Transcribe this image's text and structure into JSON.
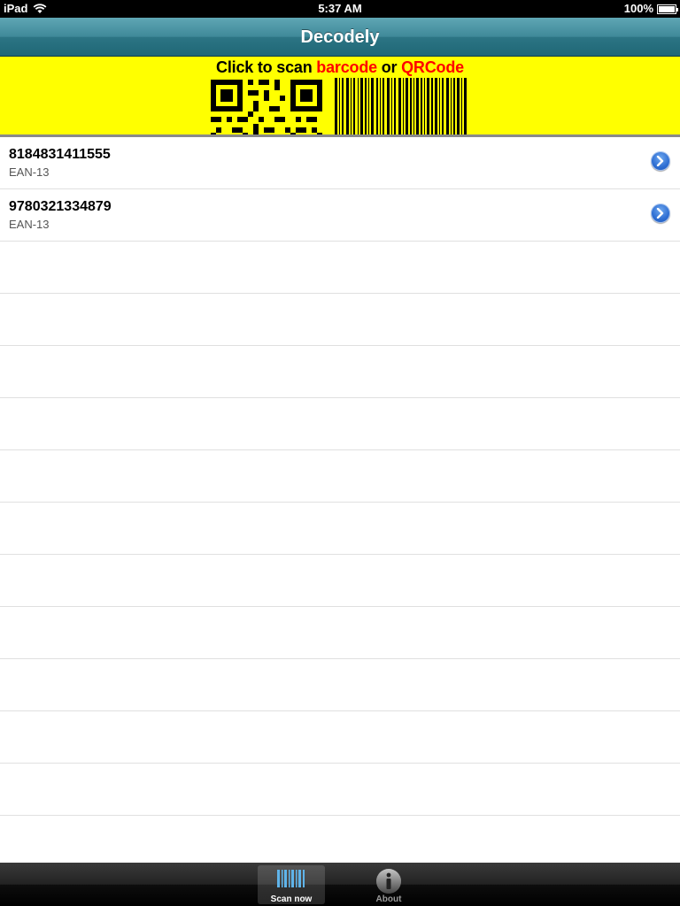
{
  "status_bar": {
    "device": "iPad",
    "time": "5:37 AM",
    "battery": "100%"
  },
  "nav": {
    "title": "Decodely"
  },
  "banner": {
    "prefix": "Click to scan ",
    "barcode": "barcode",
    "middle": " or ",
    "qrcode": "QRCode",
    "highlight_color": "#ff0000",
    "background_color": "#ffff00"
  },
  "list": {
    "items": [
      {
        "code": "8184831411555",
        "type": "EAN-13"
      },
      {
        "code": "9780321334879",
        "type": "EAN-13"
      }
    ]
  },
  "tabs": [
    {
      "label": "Scan now",
      "icon": "barcode-icon",
      "selected": true
    },
    {
      "label": "About",
      "icon": "info-icon",
      "selected": false
    }
  ],
  "colors": {
    "nav": "#3f8999",
    "disclosure": "#2f6fd3"
  }
}
